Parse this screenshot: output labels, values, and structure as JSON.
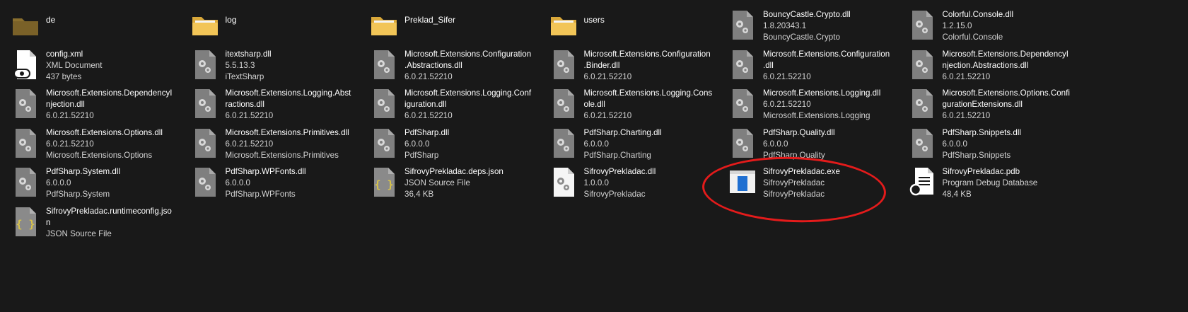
{
  "files": [
    {
      "name": "de",
      "type": "folder",
      "lines": []
    },
    {
      "name": "log",
      "type": "folder-light",
      "lines": []
    },
    {
      "name": "Preklad_Sifer",
      "type": "folder-light",
      "lines": []
    },
    {
      "name": "users",
      "type": "folder-light",
      "lines": []
    },
    {
      "name": "BouncyCastle.Crypto.dll",
      "type": "dll",
      "lines": [
        "1.8.20343.1",
        "BouncyCastle.Crypto"
      ]
    },
    {
      "name": "Colorful.Console.dll",
      "type": "dll",
      "lines": [
        "1.2.15.0",
        "Colorful.Console"
      ]
    },
    {
      "name": "config.xml",
      "type": "xml",
      "lines": [
        "XML Document",
        "437 bytes"
      ]
    },
    {
      "name": "itextsharp.dll",
      "type": "dll",
      "lines": [
        "5.5.13.3",
        "iTextSharp"
      ]
    },
    {
      "name": "Microsoft.Extensions.Configuration",
      "name2": ".Abstractions.dll",
      "type": "dll",
      "lines": [
        "6.0.21.52210"
      ]
    },
    {
      "name": "Microsoft.Extensions.Configuration",
      "name2": ".Binder.dll",
      "type": "dll",
      "lines": [
        "6.0.21.52210"
      ]
    },
    {
      "name": "Microsoft.Extensions.Configuration",
      "name2": ".dll",
      "type": "dll",
      "lines": [
        "6.0.21.52210"
      ]
    },
    {
      "name": "Microsoft.Extensions.DependencyI",
      "name2": "njection.Abstractions.dll",
      "type": "dll",
      "lines": [
        "6.0.21.52210"
      ]
    },
    {
      "name": "Microsoft.Extensions.DependencyI",
      "name2": "njection.dll",
      "type": "dll",
      "lines": [
        "6.0.21.52210"
      ]
    },
    {
      "name": "Microsoft.Extensions.Logging.Abst",
      "name2": "ractions.dll",
      "type": "dll",
      "lines": [
        "6.0.21.52210"
      ]
    },
    {
      "name": "Microsoft.Extensions.Logging.Conf",
      "name2": "iguration.dll",
      "type": "dll",
      "lines": [
        "6.0.21.52210"
      ]
    },
    {
      "name": "Microsoft.Extensions.Logging.Cons",
      "name2": "ole.dll",
      "type": "dll",
      "lines": [
        "6.0.21.52210"
      ]
    },
    {
      "name": "Microsoft.Extensions.Logging.dll",
      "type": "dll",
      "lines": [
        "6.0.21.52210",
        "Microsoft.Extensions.Logging"
      ]
    },
    {
      "name": "Microsoft.Extensions.Options.Confi",
      "name2": "gurationExtensions.dll",
      "type": "dll",
      "lines": [
        "6.0.21.52210"
      ]
    },
    {
      "name": "Microsoft.Extensions.Options.dll",
      "type": "dll",
      "lines": [
        "6.0.21.52210",
        "Microsoft.Extensions.Options"
      ]
    },
    {
      "name": "Microsoft.Extensions.Primitives.dll",
      "type": "dll",
      "lines": [
        "6.0.21.52210",
        "Microsoft.Extensions.Primitives"
      ]
    },
    {
      "name": "PdfSharp.dll",
      "type": "dll",
      "lines": [
        "6.0.0.0",
        "PdfSharp"
      ]
    },
    {
      "name": "PdfSharp.Charting.dll",
      "type": "dll",
      "lines": [
        "6.0.0.0",
        "PdfSharp.Charting"
      ]
    },
    {
      "name": "PdfSharp.Quality.dll",
      "type": "dll",
      "lines": [
        "6.0.0.0",
        "PdfSharp.Quality"
      ]
    },
    {
      "name": "PdfSharp.Snippets.dll",
      "type": "dll",
      "lines": [
        "6.0.0.0",
        "PdfSharp.Snippets"
      ]
    },
    {
      "name": "PdfSharp.System.dll",
      "type": "dll",
      "lines": [
        "6.0.0.0",
        "PdfSharp.System"
      ]
    },
    {
      "name": "PdfSharp.WPFonts.dll",
      "type": "dll",
      "lines": [
        "6.0.0.0",
        "PdfSharp.WPFonts"
      ]
    },
    {
      "name": "SifrovyPrekladac.deps.json",
      "type": "json",
      "lines": [
        "JSON Source File",
        "36,4 KB"
      ]
    },
    {
      "name": "SifrovyPrekladac.dll",
      "type": "dll-white",
      "lines": [
        "1.0.0.0",
        "SifrovyPrekladac"
      ]
    },
    {
      "name": "SifrovyPrekladac.exe",
      "type": "exe",
      "lines": [
        "SifrovyPrekladac",
        "SifrovyPrekladac"
      ]
    },
    {
      "name": "SifrovyPrekladac.pdb",
      "type": "pdb",
      "lines": [
        "Program Debug Database",
        "48,4 KB"
      ]
    },
    {
      "name": "SifrovyPrekladac.runtimeconfig.jso",
      "name2": "n",
      "type": "json",
      "lines": [
        "JSON Source File"
      ]
    }
  ],
  "annotation": {
    "color": "#e41b1b",
    "target": "SifrovyPrekladac.exe"
  }
}
